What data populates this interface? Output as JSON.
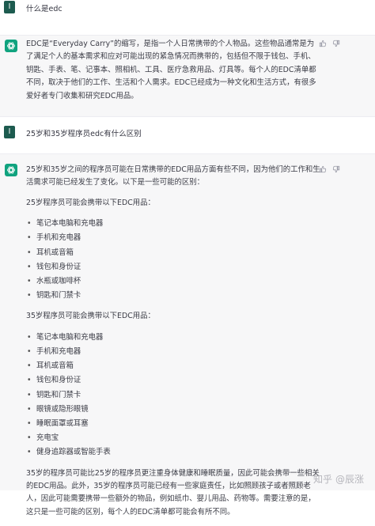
{
  "messages": [
    {
      "role": "user",
      "avatar_letter": "I",
      "text": "什么是edc"
    },
    {
      "role": "assistant",
      "text": "EDC是“Everyday Carry”的缩写，是指一个人日常携带的个人物品。这些物品通常是为了满足个人的基本需求和应对可能出现的紧急情况而携带的，包括但不限于钱包、手机、钥匙、手表、笔、记事本、照相机、工具、医疗急救用品、灯具等。每个人的EDC清单都不同，取决于他们的工作、生活和个人需求。EDC已经成为一种文化和生活方式，有很多爱好者专门收集和研究EDC用品。"
    },
    {
      "role": "user",
      "avatar_letter": "I",
      "text": "25岁和35岁程序员edc有什么区别"
    },
    {
      "role": "assistant",
      "intro": "25岁和35岁之间的程序员可能在日常携带的EDC用品方面有些不同，因为他们的工作和生活需求可能已经发生了变化。以下是一些可能的区别：",
      "section1_title": "25岁程序员可能会携带以下EDC用品：",
      "section1_items": [
        "笔记本电脑和充电器",
        "手机和充电器",
        "耳机或音箱",
        "钱包和身份证",
        "水瓶或咖啡杯",
        "钥匙和门禁卡"
      ],
      "section2_title": "35岁程序员可能会携带以下EDC用品：",
      "section2_items": [
        "笔记本电脑和充电器",
        "手机和充电器",
        "耳机或音箱",
        "钱包和身份证",
        "钥匙和门禁卡",
        "眼镜或隐形眼镜",
        "睡眠面罩或耳塞",
        "充电宝",
        "健身追踪器或智能手表"
      ],
      "conclusion": "35岁的程序员可能比25岁的程序员更注重身体健康和睡眠质量，因此可能会携带一些相关的EDC用品。此外，35岁的程序员可能已经有一些家庭责任，比如照顾孩子或者照顾老人，因此可能需要携带一些额外的物品，例如纸巾、婴儿用品、药物等。需要注意的是，这只是一些可能的区别，每个人的EDC清单都可能会有所不同。"
    }
  ],
  "watermark": {
    "site": "知乎",
    "author": "@辰涨"
  },
  "colors": {
    "accent": "#10a37f",
    "user_avatar": "#1d5b4f",
    "assistant_bg": "#f7f7f8"
  }
}
